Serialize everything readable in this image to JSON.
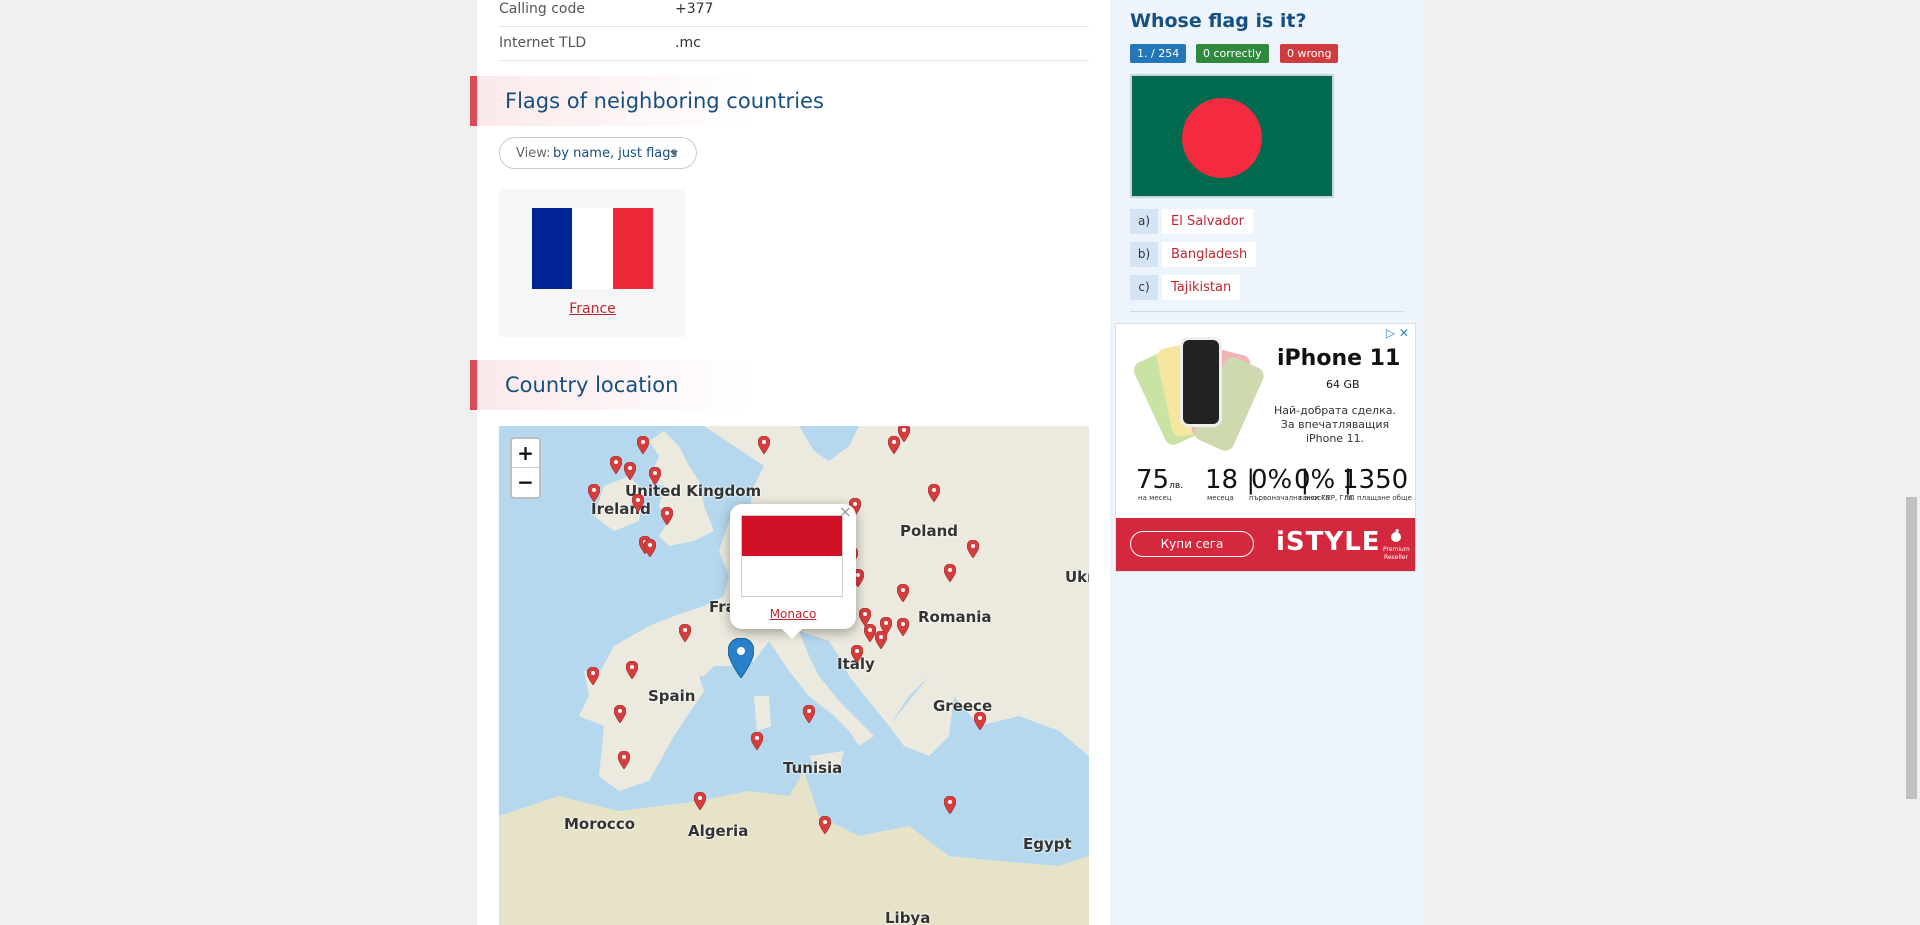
{
  "country_info": [
    {
      "label": "Calling code",
      "value": "+377"
    },
    {
      "label": "Internet TLD",
      "value": ".mc"
    }
  ],
  "neighbors_section": {
    "title": "Flags of neighboring countries",
    "view_label": "View:",
    "view_value": "by name, just flags",
    "countries": [
      {
        "name": "France",
        "colors": [
          "#002395",
          "#ffffff",
          "#ed2939"
        ]
      }
    ]
  },
  "location_section": {
    "title": "Country location",
    "zoom_in": "+",
    "zoom_out": "−",
    "labels": [
      "United Kingdom",
      "Ireland",
      "Poland",
      "France",
      "Romania",
      "Ukr",
      "Italy",
      "Spain",
      "Greece",
      "Tunisia",
      "Morocco",
      "Algeria",
      "Libya",
      "Egypt"
    ],
    "popup": {
      "country": "Monaco",
      "close": "×",
      "colors": [
        "#ce1126",
        "#ffffff"
      ]
    }
  },
  "quiz": {
    "title": "Whose flag is it?",
    "progress": "1. / 254",
    "correct": "0 correctly",
    "wrong": "0 wrong",
    "flag_colors": {
      "field": "#006a4e",
      "disc": "#f42a41"
    },
    "options": [
      {
        "letter": "a)",
        "answer": "El Salvador"
      },
      {
        "letter": "b)",
        "answer": "Bangladesh"
      },
      {
        "letter": "c)",
        "answer": "Tajikistan"
      }
    ]
  },
  "ad": {
    "icons": "▷ ✕",
    "product": "iPhone 11",
    "capacity": "64 GB",
    "deal": "Най-добрата сделка. За впечатляващия iPhone 11.",
    "stats": [
      {
        "value": "75",
        "unit": "лв.",
        "caption": "на месец"
      },
      {
        "value": "18 |",
        "caption": "месеца"
      },
      {
        "value": "0% |",
        "caption": "първоначална вноска"
      },
      {
        "value": "0% |",
        "caption": "такси ГПР, ГЛП"
      },
      {
        "value": "1350",
        "caption": "лв. плащане обще лв."
      }
    ],
    "cta": "Купи сега",
    "brand": "iSTYLE",
    "reseller": "Premium Reseller"
  },
  "colors": {
    "accent_blue": "#164f82",
    "accent_red": "#d94a56",
    "map_water": "#b5d8ee",
    "map_land": "#eceade"
  }
}
